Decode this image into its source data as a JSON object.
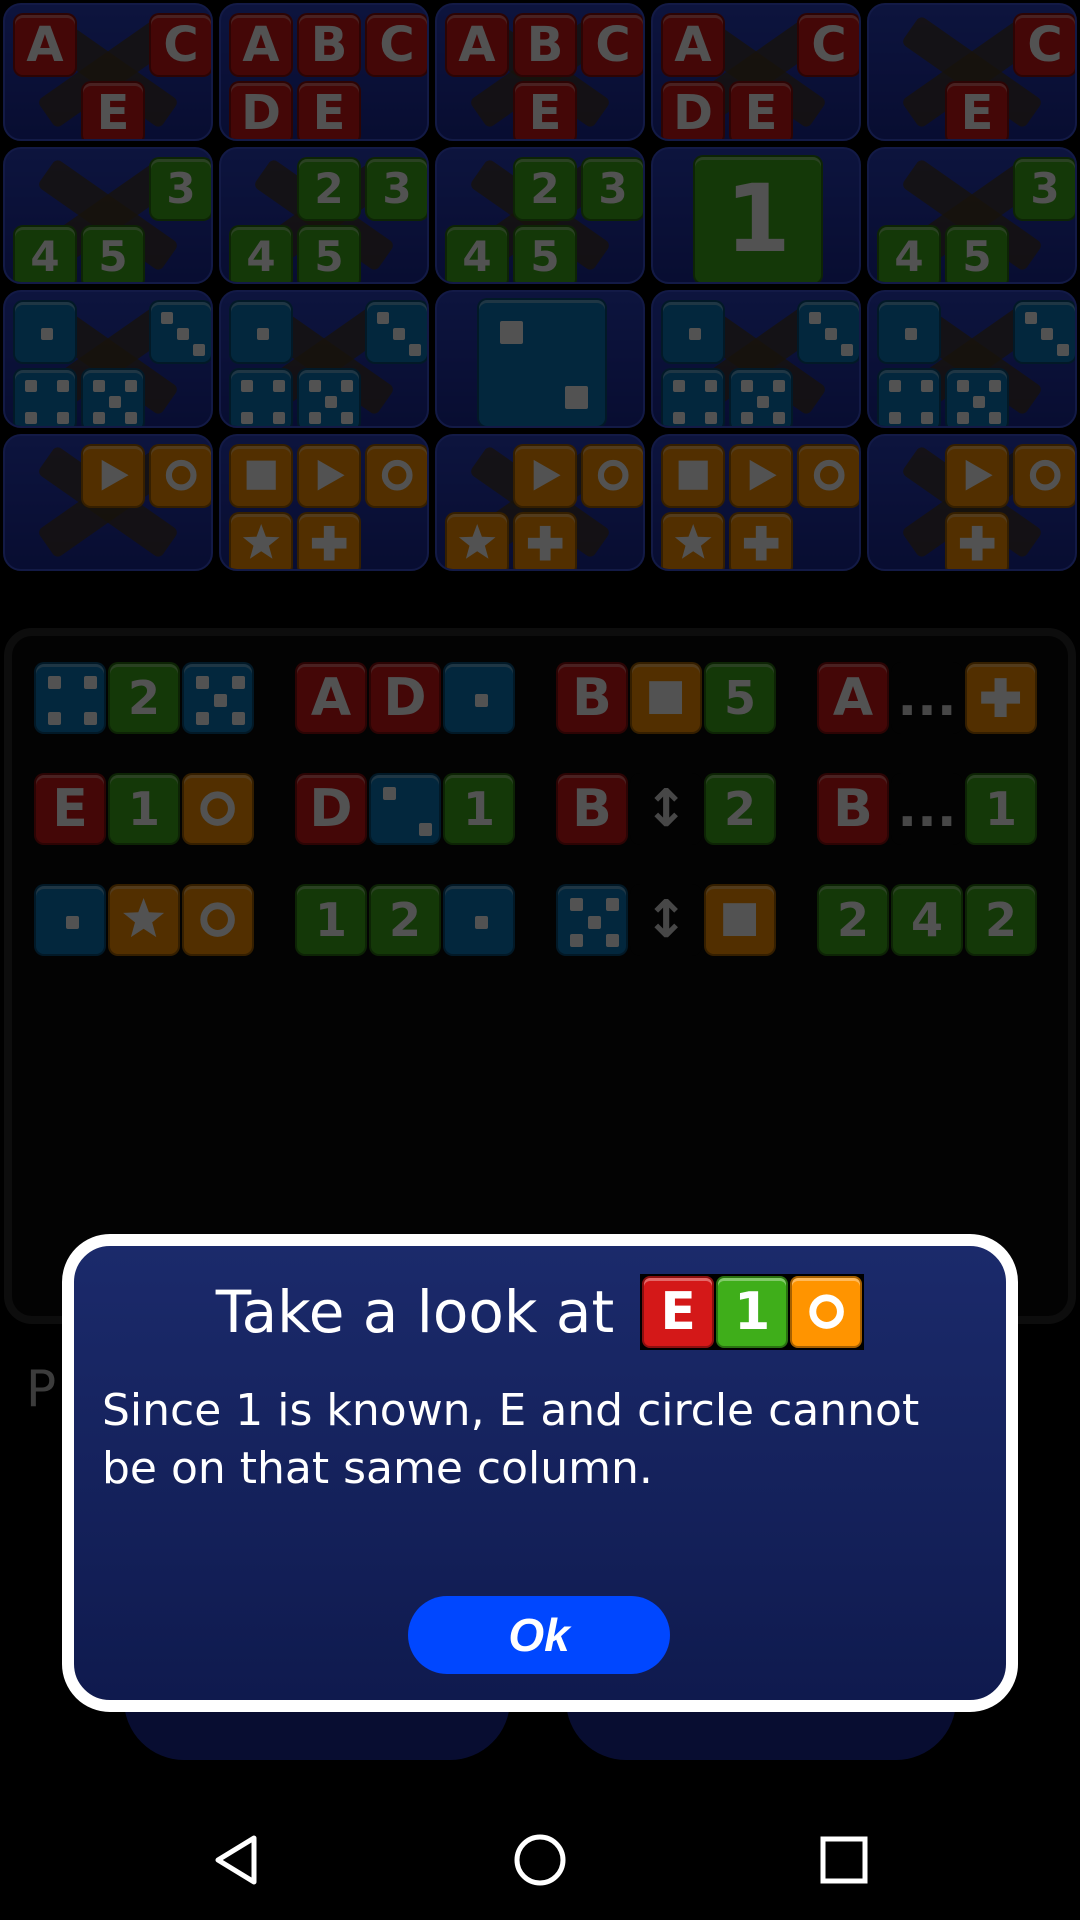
{
  "colors": {
    "red": "#d41818",
    "green": "#3fae1a",
    "blue": "#0b79bd",
    "orange": "#ff9400",
    "cell_blue": "#1a2a9a",
    "dialog_blue": "#1b2a6b",
    "ok_blue": "#0047ff"
  },
  "grid": {
    "rows": [
      {
        "category": "letters",
        "color": "red",
        "cells": [
          {
            "slots": [
              "A",
              "",
              "C",
              "",
              "E",
              ""
            ],
            "crossed": true
          },
          {
            "slots": [
              "A",
              "B",
              "C",
              "D",
              "E",
              ""
            ],
            "crossed": false
          },
          {
            "slots": [
              "A",
              "B",
              "C",
              "",
              "E",
              ""
            ],
            "crossed": true
          },
          {
            "slots": [
              "A",
              "",
              "C",
              "D",
              "E",
              ""
            ],
            "crossed": true
          },
          {
            "slots": [
              "",
              "",
              "C",
              "",
              "E",
              ""
            ],
            "crossed": true
          }
        ]
      },
      {
        "category": "numbers",
        "color": "green",
        "cells": [
          {
            "slots": [
              "",
              "",
              "3",
              "4",
              "5",
              ""
            ],
            "crossed": true
          },
          {
            "slots": [
              "",
              "2",
              "3",
              "4",
              "5",
              ""
            ],
            "crossed": true
          },
          {
            "slots": [
              "",
              "2",
              "3",
              "4",
              "5",
              ""
            ],
            "crossed": true
          },
          {
            "solved": "1"
          },
          {
            "slots": [
              "",
              "",
              "3",
              "4",
              "5",
              ""
            ],
            "crossed": true
          }
        ]
      },
      {
        "category": "dice",
        "color": "blue",
        "cells": [
          {
            "slots": [
              "die-1",
              "",
              "die-3",
              "die-4",
              "die-5",
              ""
            ],
            "crossed": true
          },
          {
            "slots": [
              "die-1",
              "",
              "die-3",
              "die-4",
              "die-5",
              ""
            ],
            "crossed": true
          },
          {
            "solved": "die-2"
          },
          {
            "slots": [
              "die-1",
              "",
              "die-3",
              "die-4",
              "die-5",
              ""
            ],
            "crossed": true
          },
          {
            "slots": [
              "die-1",
              "",
              "die-3",
              "die-4",
              "die-5",
              ""
            ],
            "crossed": true
          }
        ]
      },
      {
        "category": "shapes",
        "color": "orange",
        "cells": [
          {
            "slots": [
              "",
              "play-icon",
              "circle-icon",
              "",
              "",
              ""
            ],
            "crossed": true
          },
          {
            "slots": [
              "square-icon",
              "play-icon",
              "circle-icon",
              "star-icon",
              "plus-icon",
              ""
            ],
            "crossed": false
          },
          {
            "slots": [
              "",
              "play-icon",
              "circle-icon",
              "star-icon",
              "plus-icon",
              ""
            ],
            "crossed": true
          },
          {
            "slots": [
              "square-icon",
              "play-icon",
              "circle-icon",
              "star-icon",
              "plus-icon",
              ""
            ],
            "crossed": false
          },
          {
            "slots": [
              "",
              "play-icon",
              "circle-icon",
              "",
              "plus-icon",
              ""
            ],
            "crossed": true
          }
        ]
      }
    ]
  },
  "clues": [
    [
      {
        "t": "blue",
        "v": "die-4"
      },
      {
        "t": "green",
        "v": "2"
      },
      {
        "t": "blue",
        "v": "die-5"
      }
    ],
    [
      {
        "t": "red",
        "v": "A"
      },
      {
        "t": "red",
        "v": "D"
      },
      {
        "t": "blue",
        "v": "die-1"
      }
    ],
    [
      {
        "t": "red",
        "v": "B"
      },
      {
        "t": "orange",
        "v": "square-icon"
      },
      {
        "t": "green",
        "v": "5"
      }
    ],
    [
      {
        "t": "red",
        "v": "A"
      },
      {
        "t": "empty",
        "v": "..."
      },
      {
        "t": "orange",
        "v": "plus-icon"
      }
    ],
    [
      {
        "t": "red",
        "v": "E"
      },
      {
        "t": "green",
        "v": "1"
      },
      {
        "t": "orange",
        "v": "circle-icon"
      }
    ],
    [
      {
        "t": "red",
        "v": "D"
      },
      {
        "t": "blue",
        "v": "die-2"
      },
      {
        "t": "green",
        "v": "1"
      }
    ],
    [
      {
        "t": "red",
        "v": "B"
      },
      {
        "t": "empty",
        "v": "↕"
      },
      {
        "t": "green",
        "v": "2"
      }
    ],
    [
      {
        "t": "red",
        "v": "B"
      },
      {
        "t": "empty",
        "v": "..."
      },
      {
        "t": "green",
        "v": "1"
      }
    ],
    [
      {
        "t": "blue",
        "v": "die-1"
      },
      {
        "t": "orange",
        "v": "star-icon"
      },
      {
        "t": "orange",
        "v": "circle-icon"
      }
    ],
    [
      {
        "t": "green",
        "v": "1"
      },
      {
        "t": "green",
        "v": "2"
      },
      {
        "t": "blue",
        "v": "die-1"
      }
    ],
    [
      {
        "t": "blue",
        "v": "die-5"
      },
      {
        "t": "empty",
        "v": "↕"
      },
      {
        "t": "orange",
        "v": "square-icon"
      }
    ],
    [
      {
        "t": "green",
        "v": "2"
      },
      {
        "t": "green",
        "v": "4"
      },
      {
        "t": "green",
        "v": "2"
      }
    ]
  ],
  "background": {
    "partial_label": "P"
  },
  "dialog": {
    "title": "Take a look at",
    "title_tiles": [
      {
        "t": "red",
        "v": "E"
      },
      {
        "t": "green",
        "v": "1"
      },
      {
        "t": "orange",
        "v": "circle-icon"
      }
    ],
    "message": "Since 1 is known, E and circle cannot be on that same column.",
    "ok_label": "Ok"
  },
  "nav": {
    "back": "back-icon",
    "home": "home-icon",
    "recents": "recents-icon"
  }
}
